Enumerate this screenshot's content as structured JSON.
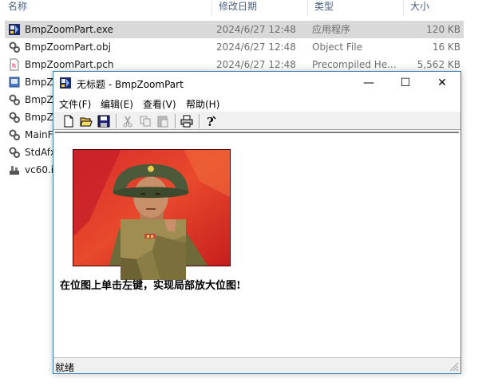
{
  "explorer": {
    "columns": {
      "name": "名称",
      "modified": "修改日期",
      "type": "类型",
      "size": "大小"
    },
    "rows": [
      {
        "name": "BmpZoomPart.exe",
        "date": "2024/6/27 12:48",
        "type": "应用程序",
        "size": "120 KB",
        "icon": "exe-icon",
        "selected": true
      },
      {
        "name": "BmpZoomPart.obj",
        "date": "2024/6/27 12:48",
        "type": "Object File",
        "size": "16 KB",
        "icon": "obj-file-icon"
      },
      {
        "name": "BmpZoomPart.pch",
        "date": "2024/6/27 12:48",
        "type": "Precompiled He...",
        "size": "5,562 KB",
        "icon": "pch-file-icon"
      },
      {
        "name": "BmpZ",
        "icon": "file-icon"
      },
      {
        "name": "BmpZ",
        "icon": "obj-file-icon"
      },
      {
        "name": "BmpZ",
        "icon": "obj-file-icon"
      },
      {
        "name": "MainF",
        "icon": "obj-file-icon"
      },
      {
        "name": "StdAfx",
        "icon": "obj-file-icon"
      },
      {
        "name": "vc60.id",
        "icon": "idb-file-icon"
      }
    ]
  },
  "window": {
    "title": "无标题 - BmpZoomPart",
    "controls": {
      "minimize": "—",
      "maximize": "☐",
      "close": "✕"
    },
    "menu": [
      "文件(F)",
      "编辑(E)",
      "查看(V)",
      "帮助(H)"
    ],
    "toolbar": [
      "new-icon",
      "open-icon",
      "save-icon",
      "cut-icon",
      "copy-icon",
      "paste-icon",
      "print-icon",
      "help-icon"
    ],
    "caption": "在位图上单击左键，实现局部放大位图!",
    "status": "就绪"
  },
  "colors": {
    "accent_border": "#3c7fb1",
    "selection": "#d9d9d9",
    "toolbar_bg": "#f0f0f0"
  }
}
